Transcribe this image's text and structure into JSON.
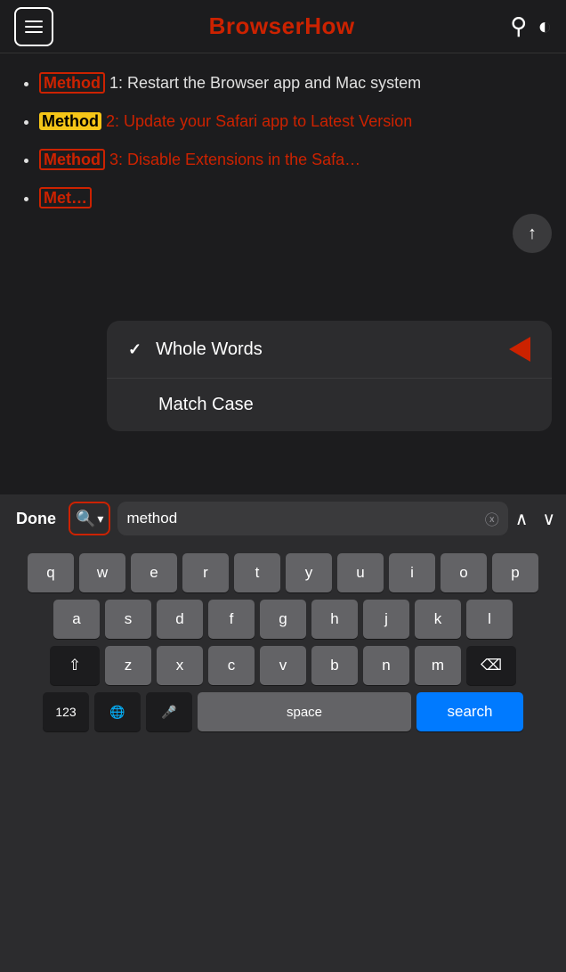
{
  "header": {
    "title": "BrowserHow",
    "menu_label": "menu",
    "search_label": "search",
    "theme_label": "theme-toggle"
  },
  "content": {
    "items": [
      {
        "tag": "Method",
        "tag_style": "red",
        "text": "1: Restart the Browser app and Mac system"
      },
      {
        "tag": "Method",
        "tag_style": "yellow",
        "text": "2: Update your Safari app to Latest Version"
      },
      {
        "tag": "Method",
        "tag_style": "red",
        "text": "3: Disable Extensions in the Safa…"
      },
      {
        "tag": "Met…",
        "tag_style": "red",
        "text": ""
      }
    ]
  },
  "dropdown": {
    "items": [
      {
        "label": "Whole Words",
        "checked": true
      },
      {
        "label": "Match Case",
        "checked": false
      }
    ]
  },
  "find_bar": {
    "done_label": "Done",
    "search_value": "method",
    "clear_label": "×",
    "up_label": "∧",
    "down_label": "∨"
  },
  "keyboard": {
    "rows": [
      [
        "q",
        "w",
        "e",
        "r",
        "t",
        "y",
        "u",
        "i",
        "o",
        "p"
      ],
      [
        "a",
        "s",
        "d",
        "f",
        "g",
        "h",
        "j",
        "k",
        "l"
      ],
      [
        "z",
        "x",
        "c",
        "v",
        "b",
        "n",
        "m"
      ]
    ],
    "space_label": "space",
    "search_label": "search",
    "numbers_label": "123",
    "globe_label": "🌐",
    "mic_label": "🎤",
    "delete_label": "⌫",
    "shift_label": "⇧"
  },
  "scroll_up_label": "↑",
  "colors": {
    "red": "#cc2200",
    "yellow": "#f5c518",
    "blue": "#007aff",
    "dark_bg": "#1c1c1e",
    "card_bg": "#2c2c2e",
    "key_bg": "#636366"
  }
}
